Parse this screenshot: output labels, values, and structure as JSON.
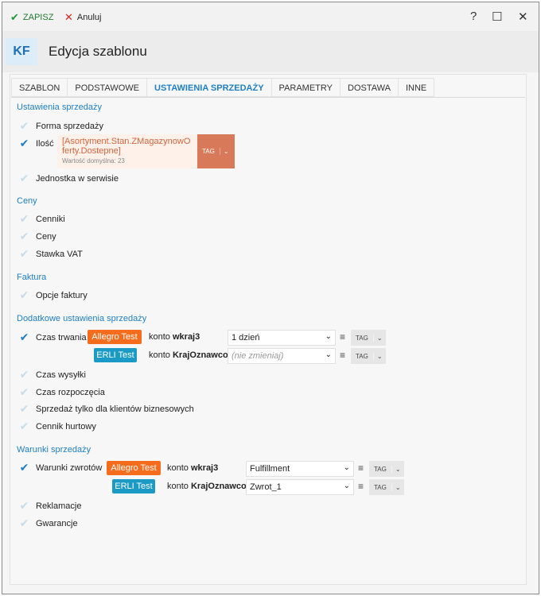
{
  "toolbar": {
    "save_label": "ZAPISZ",
    "cancel_label": "Anuluj",
    "help_label": "?",
    "maximize_label": "☐",
    "close_label": "✕"
  },
  "header": {
    "logo": "KF",
    "title": "Edycja szablonu"
  },
  "tabs": [
    {
      "label": "SZABLON",
      "active": false
    },
    {
      "label": "PODSTAWOWE",
      "active": false
    },
    {
      "label": "USTAWIENIA SPRZEDAŻY",
      "active": true
    },
    {
      "label": "PARAMETRY",
      "active": false
    },
    {
      "label": "DOSTAWA",
      "active": false
    },
    {
      "label": "INNE",
      "active": false
    }
  ],
  "sections": {
    "sales": "Ustawienia sprzedaży",
    "prices": "Ceny",
    "invoice": "Faktura",
    "additional": "Dodatkowe ustawienia sprzedaży",
    "conditions": "Warunki sprzedaży"
  },
  "items": {
    "forma": {
      "label": "Forma sprzedaży",
      "checked": false
    },
    "ilosc": {
      "label": "Ilość",
      "checked": true
    },
    "jednostka": {
      "label": "Jednostka w serwisie",
      "checked": false
    },
    "cenniki": {
      "label": "Cenniki",
      "checked": false
    },
    "ceny": {
      "label": "Ceny",
      "checked": false
    },
    "vat": {
      "label": "Stawka VAT",
      "checked": false
    },
    "opcje": {
      "label": "Opcje faktury",
      "checked": false
    },
    "czas_trwania": {
      "label": "Czas trwania",
      "checked": true
    },
    "czas_wysylki": {
      "label": "Czas wysyłki",
      "checked": false
    },
    "czas_rozpoczecia": {
      "label": "Czas rozpoczęcia",
      "checked": false
    },
    "biznes": {
      "label": "Sprzedaż tylko dla klientów biznesowych",
      "checked": false
    },
    "hurtowy": {
      "label": "Cennik hurtowy",
      "checked": false
    },
    "warunki": {
      "label": "Warunki zwrotów",
      "checked": true
    },
    "reklamacje": {
      "label": "Reklamacje",
      "checked": false
    },
    "gwarancje": {
      "label": "Gwarancje",
      "checked": false
    }
  },
  "quantity": {
    "expression": "[Asortyment.Stan.ZMagazynowOferty.Dostepne]",
    "default": "Wartość domyślna: 23",
    "tag": "TAG"
  },
  "duration": {
    "allegro": {
      "badge": "Allegro Test",
      "konto": "konto",
      "account": "wkraj3",
      "value": "1 dzień",
      "tag": "TAG"
    },
    "erli": {
      "badge": "ERLI Test",
      "konto": "konto",
      "account": "KrajOznawco",
      "placeholder": "(nie zmieniaj)",
      "tag": "TAG"
    }
  },
  "returns": {
    "allegro": {
      "badge": "Allegro Test",
      "konto": "konto",
      "account": "wkraj3",
      "value": "Fulfillment",
      "tag": "TAG"
    },
    "erli": {
      "badge": "ERLI Test",
      "konto": "konto",
      "account": "KrajOznawco",
      "value": "Zwrot_1",
      "tag": "TAG"
    }
  },
  "icons": {
    "check": "✔",
    "dropdown": "⌄",
    "menu": "≡",
    "chevron": "⌄"
  },
  "colors": {
    "accent": "#1e7fc8",
    "allegro": "#f56c1c",
    "erli": "#1a9ac5",
    "save": "#1f7a2e",
    "cancel": "#dd2222"
  }
}
